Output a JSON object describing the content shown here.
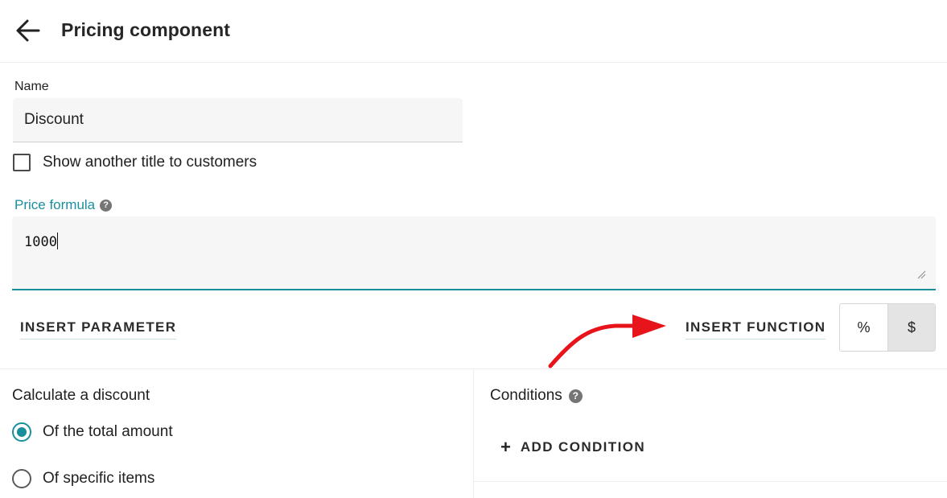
{
  "header": {
    "title": "Pricing component",
    "back_icon": "arrow-left-icon"
  },
  "name_field": {
    "label": "Name",
    "value": "Discount"
  },
  "alt_title_checkbox": {
    "label": "Show another title to customers",
    "checked": false
  },
  "price_formula": {
    "label": "Price formula",
    "help_icon": "question-circle-icon",
    "help_glyph": "?",
    "value": "1000"
  },
  "actions": {
    "insert_parameter": "INSERT PARAMETER",
    "insert_function": "INSERT FUNCTION"
  },
  "unit_toggle": {
    "options": [
      "%",
      "$"
    ],
    "selected": "$"
  },
  "calculate_discount": {
    "title": "Calculate a discount",
    "options": [
      {
        "label": "Of the total amount",
        "checked": true
      },
      {
        "label": "Of specific items",
        "checked": false
      }
    ]
  },
  "conditions": {
    "title": "Conditions",
    "help_icon": "question-circle-icon",
    "help_glyph": "?",
    "add_label": "ADD CONDITION",
    "add_icon": "plus-icon",
    "add_glyph": "+"
  },
  "colors": {
    "accent": "#1a8f9c",
    "annotation_arrow": "#e8141b"
  },
  "annotation": {
    "icon": "red-arrow-icon",
    "points_to": "insert-function-button"
  }
}
